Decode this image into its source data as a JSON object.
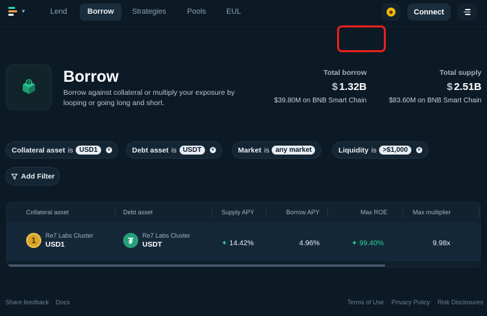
{
  "nav": {
    "items": [
      {
        "label": "Lend",
        "active": false
      },
      {
        "label": "Borrow",
        "active": true
      },
      {
        "label": "Strategies",
        "active": false
      },
      {
        "label": "Pools",
        "active": false
      },
      {
        "label": "EUL",
        "active": false
      }
    ],
    "connect_label": "Connect",
    "network_icon": "bnb-coin-icon"
  },
  "header": {
    "title": "Borrow",
    "description": "Borrow against collateral or multiply your exposure by looping or going long and short."
  },
  "stats": {
    "total_borrow": {
      "label": "Total borrow",
      "currency": "$",
      "value": "1.32B",
      "sub": "$39.80M on BNB Smart Chain"
    },
    "total_supply": {
      "label": "Total supply",
      "currency": "$",
      "value": "2.51B",
      "sub": "$83.60M on BNB Smart Chain"
    }
  },
  "filters": [
    {
      "key": "Collateral asset",
      "is": "is",
      "value": "USD1"
    },
    {
      "key": "Debt asset",
      "is": "is",
      "value": "USDT"
    },
    {
      "key": "Market",
      "is": "is",
      "value": "any market"
    },
    {
      "key": "Liquidity",
      "is": "is",
      "value": ">$1,000"
    }
  ],
  "add_filter_label": "Add Filter",
  "table": {
    "columns": [
      "Collateral asset",
      "Debt asset",
      "Supply APY",
      "Borrow APY",
      "Max ROE",
      "Max multiplier"
    ],
    "rows": [
      {
        "collateral": {
          "cluster": "Re7 Labs Cluster",
          "symbol": "USD1"
        },
        "debt": {
          "cluster": "Re7 Labs Cluster",
          "symbol": "USDT"
        },
        "supply_apy": "14.42%",
        "borrow_apy": "4.96%",
        "max_roe": "99.40%",
        "max_multiplier": "9.98x"
      }
    ]
  },
  "footer": {
    "left": [
      "Share feedback",
      "Docs"
    ],
    "right": [
      "Terms of Use",
      "Privacy Policy",
      "Risk Disclosures"
    ]
  },
  "colors": {
    "background": "#0c1a26",
    "accent_green": "#2bd39a",
    "highlight_red": "#e3211b",
    "usdt_green": "#26a17b",
    "usd1_gold": "#d9a52c"
  }
}
